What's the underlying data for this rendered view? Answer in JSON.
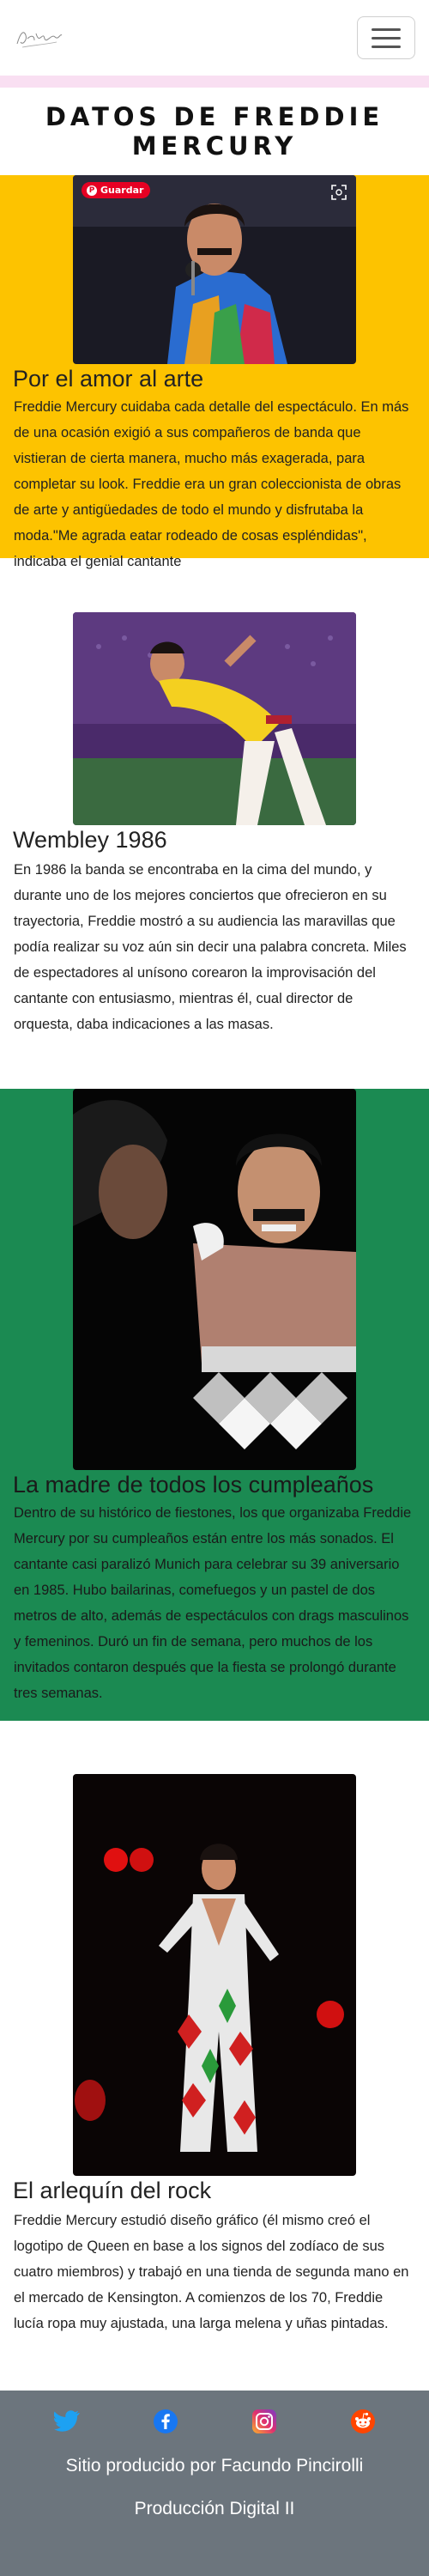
{
  "header": {
    "logo_alt": "Freddie Mercury",
    "menu_icon": "hamburger-icon"
  },
  "page_title": "DATOS DE FREDDIE MERCURY",
  "sections": [
    {
      "heading": "Por el amor al arte",
      "text": "Freddie Mercury cuidaba cada detalle del espectáculo. En más de una ocasión exigió a sus compañeros de banda que vistieran de cierta manera, mucho más exagerada, para completar su look. Freddie era un gran coleccionista de obras de arte y antigüedades de todo el mundo y disfrutaba la moda.\"Me agrada eatar rodeado de cosas espléndidas\", indicaba el genial cantante",
      "pin_label": "Guardar",
      "pin_icon": "pinterest-icon",
      "color": "#fdc300"
    },
    {
      "heading": "Wembley 1986",
      "text": "En 1986 la banda se encontraba en la cima del mundo, y durante uno de los mejores conciertos que ofrecieron en su trayectoria, Freddie mostró a su audiencia las maravillas que podía realizar su voz aún sin decir una palabra concreta. Miles de espectadores al unísono corearon la improvisación del cantante con entusiasmo, mientras él, cual director de orquesta, daba indicaciones a las masas.",
      "color": "#ffffff"
    },
    {
      "heading": "La madre de todos los cumpleaños",
      "text": "Dentro de su histórico de fiestones, los que organizaba Freddie Mercury por su cumpleaños están entre los más sonados. El cantante casi paralizó Munich para celebrar su 39 aniversario en 1985. Hubo bailarinas, comefuegos y un pastel de dos metros de alto, además de espectáculos con drags masculinos y femeninos. Duró un fin de semana, pero muchos de los invitados contaron después que la fiesta se prolongó durante tres semanas.",
      "color": "#1b8a52"
    },
    {
      "heading": "El arlequín del rock",
      "text": "Freddie Mercury estudió diseño gráfico (él mismo creó el logotipo de Queen en base a los signos del zodíaco de sus cuatro miembros) y trabajó en una tienda de segunda mano en el mercado de Kensington. A comienzos de los 70, Freddie lucía ropa muy ajustada, una larga melena y uñas pintadas.",
      "color": "#ffffff"
    }
  ],
  "footer": {
    "socials": [
      "twitter-icon",
      "facebook-icon",
      "instagram-icon",
      "reddit-icon"
    ],
    "credit": "Sitio producido por Facundo Pincirolli",
    "course": "Producción Digital II"
  }
}
